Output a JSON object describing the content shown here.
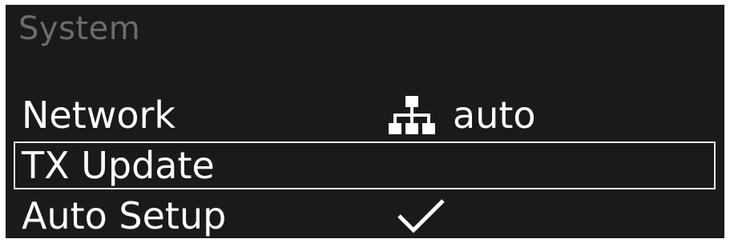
{
  "screen": {
    "title": "System",
    "menu": [
      {
        "label": "Network",
        "value": "auto",
        "icon": "network-icon",
        "selected": false
      },
      {
        "label": "TX Update",
        "selected": true
      },
      {
        "label": "Auto Setup",
        "icon": "checkmark-icon",
        "selected": false
      }
    ]
  },
  "colors": {
    "background": "#1b1a18",
    "text": "#ffffff",
    "title": "#6d6c69",
    "selection_border": "#e8e8e8"
  }
}
